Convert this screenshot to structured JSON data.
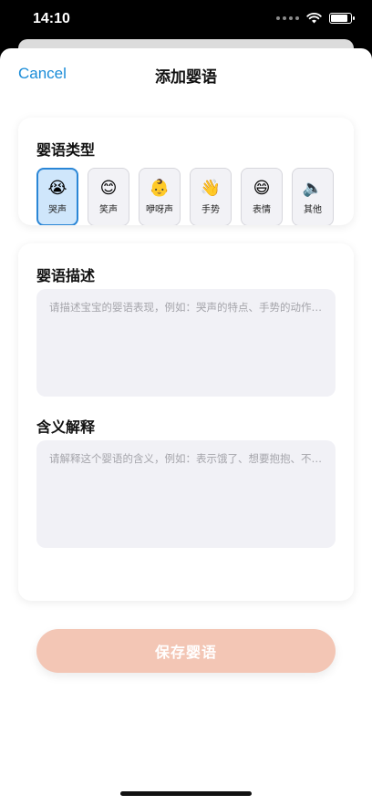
{
  "status_bar": {
    "time": "14:10"
  },
  "nav": {
    "cancel_label": "Cancel",
    "title": "添加婴语"
  },
  "type_section": {
    "title": "婴语类型",
    "selected_index": 0,
    "options": [
      {
        "emoji": "😭",
        "label": "哭声"
      },
      {
        "emoji": "😊",
        "label": "笑声"
      },
      {
        "emoji": "👶",
        "label": "咿呀声"
      },
      {
        "emoji": "👋",
        "label": "手势"
      },
      {
        "emoji": "😄",
        "label": "表情"
      },
      {
        "emoji": "🔈",
        "label": "其他"
      }
    ]
  },
  "description": {
    "title": "婴语描述",
    "placeholder": "请描述宝宝的婴语表现，例如：哭声的特点、手势的动作等..."
  },
  "meaning": {
    "title": "含义解释",
    "placeholder": "请解释这个婴语的含义，例如：表示饿了、想要抱抱、不舒服"
  },
  "save_button": {
    "label": "保存婴语"
  },
  "colors": {
    "accent": "#1a8cd8",
    "selected_bg": "#cfe6fb",
    "save_button_bg": "#f3c6b5",
    "field_bg": "#f1f1f6"
  }
}
